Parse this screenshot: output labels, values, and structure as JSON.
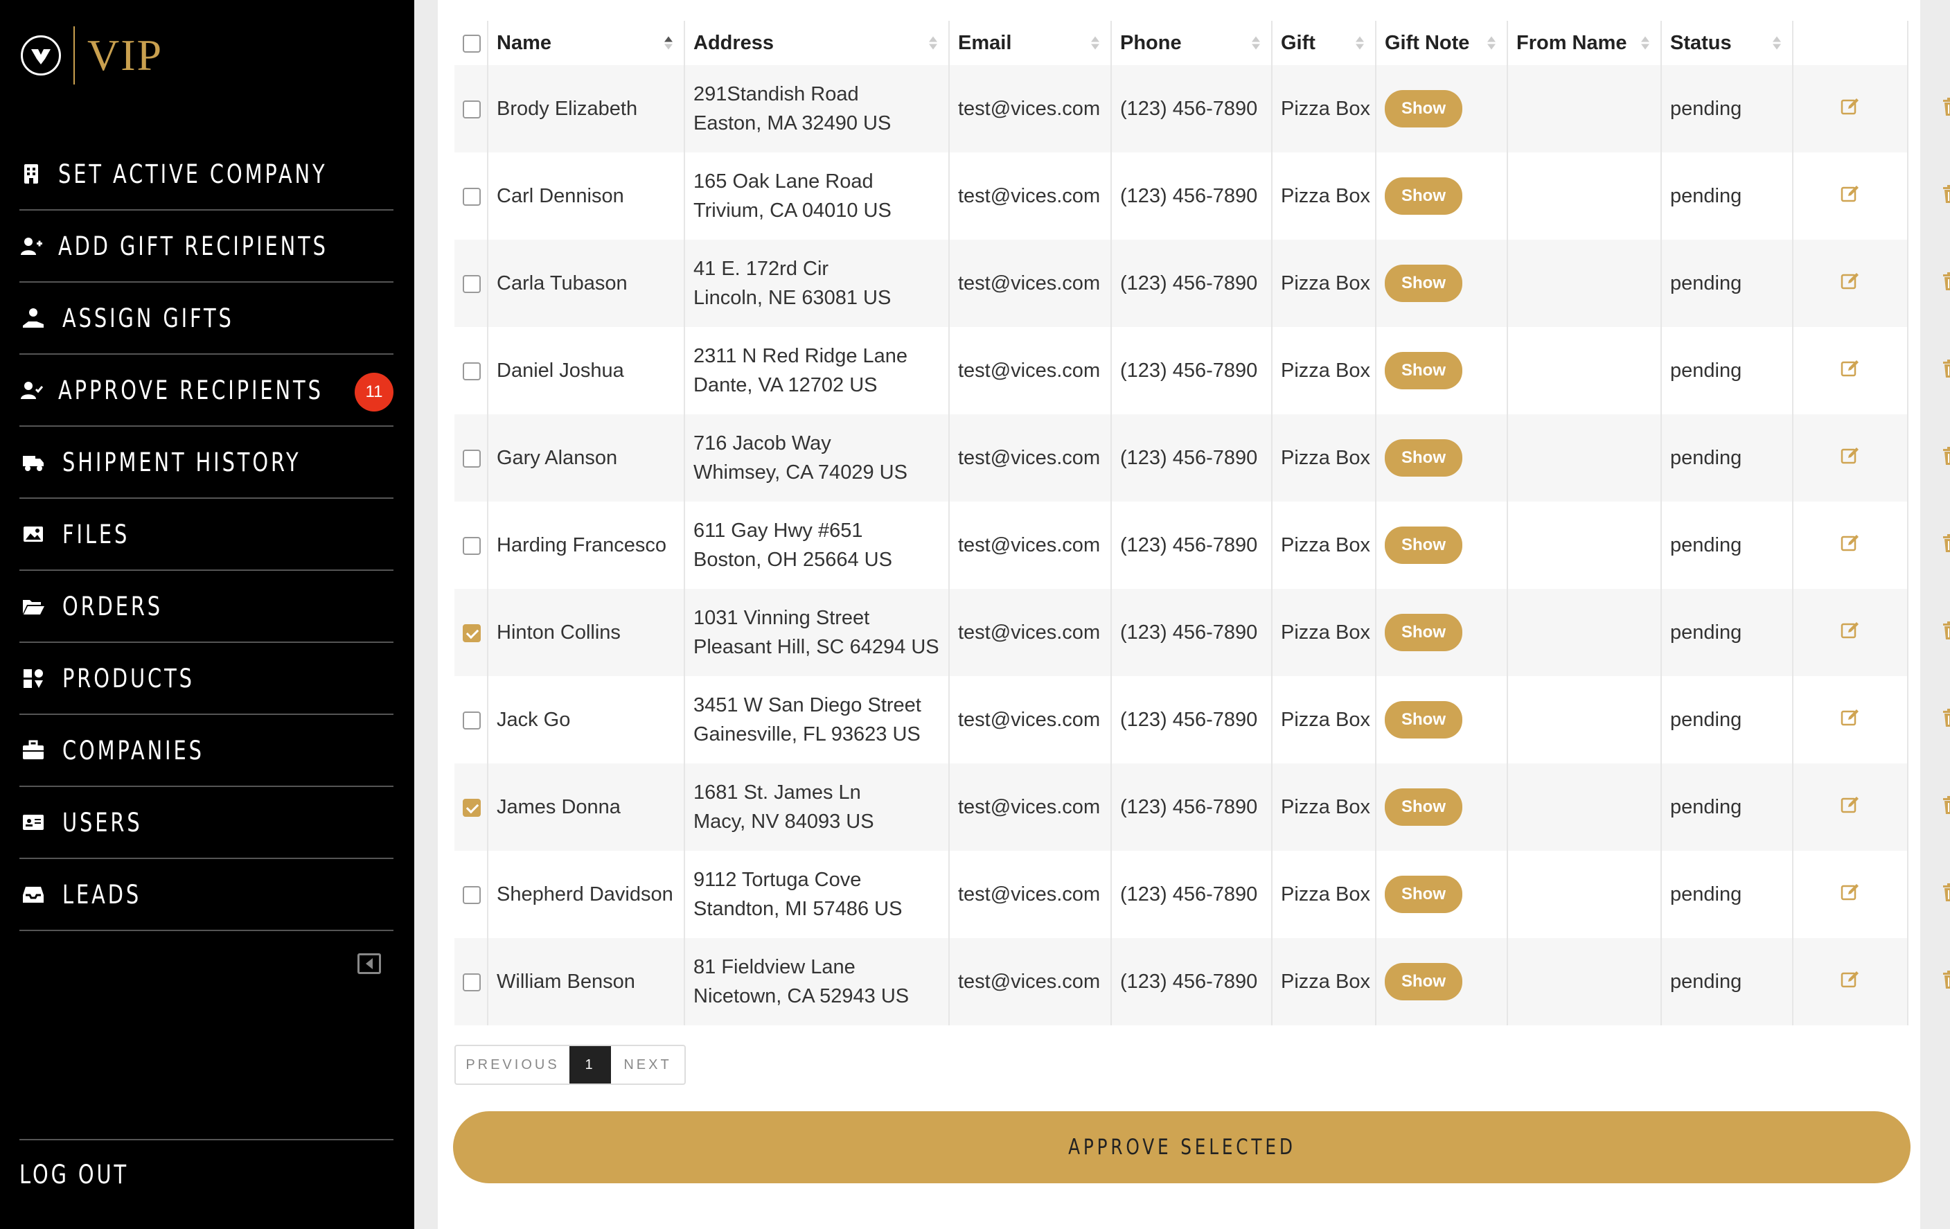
{
  "brand": {
    "logo_text": "VIP"
  },
  "sidebar": {
    "items": [
      {
        "label": "SET ACTIVE COMPANY",
        "icon": "building-icon"
      },
      {
        "label": "ADD GIFT RECIPIENTS",
        "icon": "user-plus-icon"
      },
      {
        "label": "ASSIGN GIFTS",
        "icon": "hand-gift-icon"
      },
      {
        "label": "APPROVE RECIPIENTS",
        "icon": "user-check-icon",
        "badge": "11"
      },
      {
        "label": "SHIPMENT HISTORY",
        "icon": "truck-icon"
      },
      {
        "label": "FILES",
        "icon": "image-icon"
      },
      {
        "label": "ORDERS",
        "icon": "folder-open-icon"
      },
      {
        "label": "PRODUCTS",
        "icon": "products-icon"
      },
      {
        "label": "COMPANIES",
        "icon": "briefcase-icon"
      },
      {
        "label": "USERS",
        "icon": "id-card-icon"
      },
      {
        "label": "LEADS",
        "icon": "inbox-icon"
      }
    ],
    "logout_label": "LOG OUT"
  },
  "table": {
    "columns": [
      "Name",
      "Address",
      "Email",
      "Phone",
      "Gift",
      "Gift Note",
      "From Name",
      "Status"
    ],
    "show_label": "Show",
    "rows": [
      {
        "checked": false,
        "name": "Brody Elizabeth",
        "address1": "291Standish Road",
        "address2": "Easton, MA 32490 US",
        "email": "test@vices.com",
        "phone": "(123) 456-7890",
        "gift": "Pizza Box",
        "from_name": "",
        "status": "pending"
      },
      {
        "checked": false,
        "name": "Carl Dennison",
        "address1": "165 Oak Lane Road",
        "address2": "Trivium, CA 04010 US",
        "email": "test@vices.com",
        "phone": "(123) 456-7890",
        "gift": "Pizza Box",
        "from_name": "",
        "status": "pending"
      },
      {
        "checked": false,
        "name": "Carla Tubason",
        "address1": "41 E. 172rd Cir",
        "address2": "Lincoln, NE 63081 US",
        "email": "test@vices.com",
        "phone": "(123) 456-7890",
        "gift": "Pizza Box",
        "from_name": "",
        "status": "pending"
      },
      {
        "checked": false,
        "name": "Daniel Joshua",
        "address1": "2311 N Red Ridge Lane",
        "address2": "Dante, VA 12702 US",
        "email": "test@vices.com",
        "phone": "(123) 456-7890",
        "gift": "Pizza Box",
        "from_name": "",
        "status": "pending"
      },
      {
        "checked": false,
        "name": "Gary Alanson",
        "address1": "716 Jacob Way",
        "address2": "Whimsey, CA 74029 US",
        "email": "test@vices.com",
        "phone": "(123) 456-7890",
        "gift": "Pizza Box",
        "from_name": "",
        "status": "pending"
      },
      {
        "checked": false,
        "name": "Harding Francesco",
        "address1": "611 Gay Hwy #651",
        "address2": "Boston, OH 25664 US",
        "email": "test@vices.com",
        "phone": "(123) 456-7890",
        "gift": "Pizza Box",
        "from_name": "",
        "status": "pending"
      },
      {
        "checked": true,
        "name": "Hinton Collins",
        "address1": "1031 Vinning Street",
        "address2": "Pleasant Hill, SC 64294 US",
        "email": "test@vices.com",
        "phone": "(123) 456-7890",
        "gift": "Pizza Box",
        "from_name": "",
        "status": "pending"
      },
      {
        "checked": false,
        "name": "Jack Go",
        "address1": "3451 W San Diego Street",
        "address2": "Gainesville, FL 93623 US",
        "email": "test@vices.com",
        "phone": "(123) 456-7890",
        "gift": "Pizza Box",
        "from_name": "",
        "status": "pending"
      },
      {
        "checked": true,
        "name": "James Donna",
        "address1": "1681 St. James Ln",
        "address2": "Macy, NV 84093 US",
        "email": "test@vices.com",
        "phone": "(123) 456-7890",
        "gift": "Pizza Box",
        "from_name": "",
        "status": "pending"
      },
      {
        "checked": false,
        "name": "Shepherd Davidson",
        "address1": "9112 Tortuga Cove",
        "address2": "Standton, MI 57486 US",
        "email": "test@vices.com",
        "phone": "(123) 456-7890",
        "gift": "Pizza Box",
        "from_name": "",
        "status": "pending"
      },
      {
        "checked": false,
        "name": "William Benson",
        "address1": "81 Fieldview Lane",
        "address2": "Nicetown, CA 52943 US",
        "email": "test@vices.com",
        "phone": "(123) 456-7890",
        "gift": "Pizza Box",
        "from_name": "",
        "status": "pending"
      }
    ]
  },
  "pagination": {
    "prev_label": "PREVIOUS",
    "current": "1",
    "next_label": "NEXT"
  },
  "approve_label": "APPROVE SELECTED",
  "colors": {
    "accent": "#cfa452",
    "badge": "#e8341c",
    "sidebar_bg": "#000000"
  }
}
